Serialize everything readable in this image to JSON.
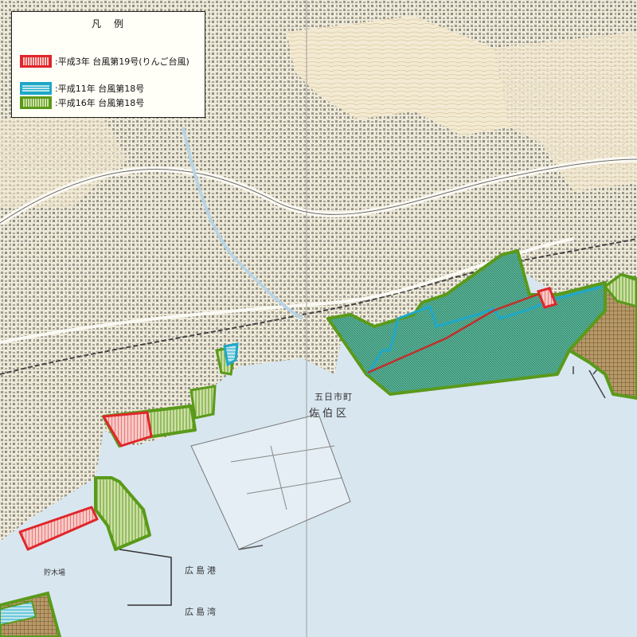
{
  "legend": {
    "title": "凡　例",
    "items": [
      {
        "label": ":平成3年 台風第19号(りんご台風)",
        "color": "#e0262b",
        "fill": "#f2a2a0"
      },
      {
        "label": ":平成11年 台風第18号",
        "color": "#1fa8c8",
        "fill": "#9fd9e4"
      },
      {
        "label": ":平成16年 台風第18号",
        "color": "#5a9a1a",
        "fill": "#b7d28a"
      }
    ]
  },
  "map_labels": {
    "town": "五日市町",
    "ward": "佐伯区",
    "port_upper": "広島港",
    "port_lower": "広島湾",
    "timber_yard": "貯木場"
  },
  "colors": {
    "land": "#f1ecd9",
    "sea": "#d8e6ef",
    "road": "#fbfaf4",
    "building": "#8f8c85",
    "contour": "#d7c49a",
    "hatch_brown": "#8b6a3e"
  }
}
